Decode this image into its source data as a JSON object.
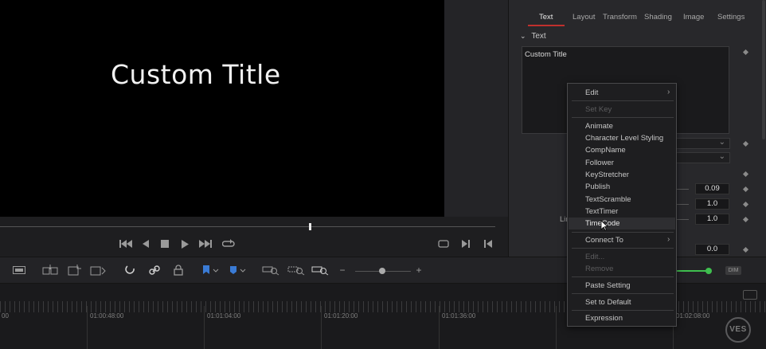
{
  "viewer": {
    "title_text": "Custom Title"
  },
  "inspector": {
    "tabs": [
      {
        "label": "Text",
        "active": true
      },
      {
        "label": "Layout",
        "active": false
      },
      {
        "label": "Transform",
        "active": false
      },
      {
        "label": "Shading",
        "active": false
      },
      {
        "label": "Image",
        "active": false
      },
      {
        "label": "Settings",
        "active": false
      }
    ],
    "section": "Text",
    "text_field_value": "Custom Title",
    "values": [
      "0.09",
      "1.0",
      "1.0",
      "0.0"
    ],
    "partial_label": "Lir"
  },
  "context_menu": {
    "items": [
      {
        "label": "Edit",
        "submenu": true,
        "disabled": false
      },
      {
        "label": "Set Key",
        "submenu": false,
        "disabled": true
      },
      {
        "label": "Animate",
        "submenu": false,
        "disabled": false
      },
      {
        "label": "Character Level Styling",
        "submenu": false,
        "disabled": false
      },
      {
        "label": "CompName",
        "submenu": false,
        "disabled": false
      },
      {
        "label": "Follower",
        "submenu": false,
        "disabled": false
      },
      {
        "label": "KeyStretcher",
        "submenu": false,
        "disabled": false
      },
      {
        "label": "Publish",
        "submenu": false,
        "disabled": false
      },
      {
        "label": "TextScramble",
        "submenu": false,
        "disabled": false
      },
      {
        "label": "TextTimer",
        "submenu": false,
        "disabled": false
      },
      {
        "label": "TimeCode",
        "submenu": false,
        "disabled": false,
        "hovered": true
      },
      {
        "label": "Connect To",
        "submenu": true,
        "disabled": false
      },
      {
        "label": "Edit...",
        "submenu": false,
        "disabled": true
      },
      {
        "label": "Remove",
        "submenu": false,
        "disabled": true
      },
      {
        "label": "Paste Setting",
        "submenu": false,
        "disabled": false
      },
      {
        "label": "Set to Default",
        "submenu": false,
        "disabled": false
      },
      {
        "label": "Expression",
        "submenu": false,
        "disabled": false
      }
    ]
  },
  "toolbar": {
    "dim_label": "DIM"
  },
  "timeline": {
    "timecodes": [
      "00",
      "01:00:48:00",
      "01:01:04:00",
      "01:01:20:00",
      "01:01:36:00",
      "01:02:08:00"
    ]
  },
  "branding": {
    "logo_text": "VES"
  },
  "icons": {
    "transport": [
      "skip-to-start-icon",
      "step-back-icon",
      "stop-icon",
      "play-icon",
      "skip-to-end-icon",
      "loop-icon"
    ],
    "viewer_right": [
      "match-frame-icon",
      "next-edit-icon",
      "prev-edit-icon"
    ],
    "toolbar": [
      "trim-icon",
      "insert-icon",
      "overwrite-icon",
      "replace-icon",
      "snapping-icon",
      "link-icon",
      "lock-icon",
      "flag-icon",
      "marker-icon",
      "zoom-full-icon",
      "zoom-detail-icon",
      "zoom-custom-icon",
      "zoom-out-icon",
      "zoom-in-icon"
    ]
  },
  "colors": {
    "accent_red": "#c0302d",
    "flag_blue": "#3a7bd5",
    "audio_green": "#3fbf4f"
  }
}
